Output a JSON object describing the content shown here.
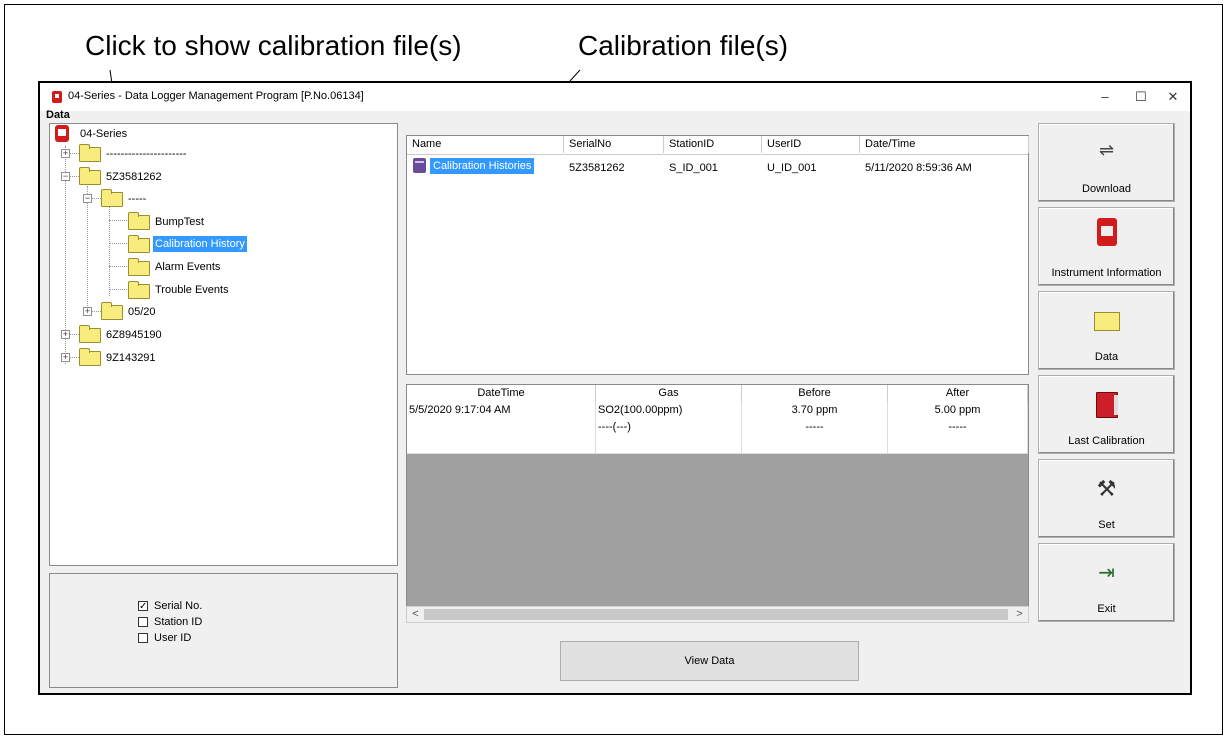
{
  "callouts": {
    "left": "Click to show calibration file(s)",
    "right": "Calibration file(s)"
  },
  "window": {
    "title": "04-Series - Data Logger Management Program [P.No.06134]",
    "minimize": "–",
    "maximize": "☐",
    "close": "✕"
  },
  "data_group_label": "Data",
  "tree": {
    "root": "04-Series",
    "n1": "----------------------",
    "n2": "5Z3581262",
    "n2a": "-----",
    "bump": "BumpTest",
    "calib": "Calibration History",
    "alarm": "Alarm Events",
    "trouble": "Trouble Events",
    "n2b": "05/20",
    "n3": "6Z8945190",
    "n4": "9Z143291"
  },
  "options": {
    "serial": "Serial No.",
    "station": "Station ID",
    "user": "User ID",
    "serial_checked": true,
    "station_checked": false,
    "user_checked": false,
    "check_mark": "✓"
  },
  "file_list": {
    "columns": [
      "Name",
      "SerialNo",
      "StationID",
      "UserID",
      "Date/Time"
    ],
    "row": {
      "name": "Calibration Histories",
      "serial": "5Z3581262",
      "station": "S_ID_001",
      "user": "U_ID_001",
      "datetime": "5/11/2020 8:59:36 AM"
    }
  },
  "detail_grid": {
    "columns": [
      "DateTime",
      "Gas",
      "Before",
      "After"
    ],
    "rows": [
      [
        "5/5/2020 9:17:04 AM",
        "SO2(100.00ppm)",
        "3.70 ppm",
        "5.00 ppm"
      ],
      [
        "",
        "----(---)",
        "-----",
        "-----"
      ],
      [
        "",
        "",
        "",
        ""
      ]
    ]
  },
  "scroll": {
    "left": "<",
    "right": ">"
  },
  "view_data_label": "View Data",
  "side_buttons": {
    "download": "Download",
    "instrument": "Instrument Information",
    "data": "Data",
    "last_calibration": "Last Calibration",
    "set": "Set",
    "exit": "Exit"
  },
  "icons": {
    "download_glyph": "⇌",
    "set_glyph": "⚒",
    "exit_glyph": "⇥"
  }
}
